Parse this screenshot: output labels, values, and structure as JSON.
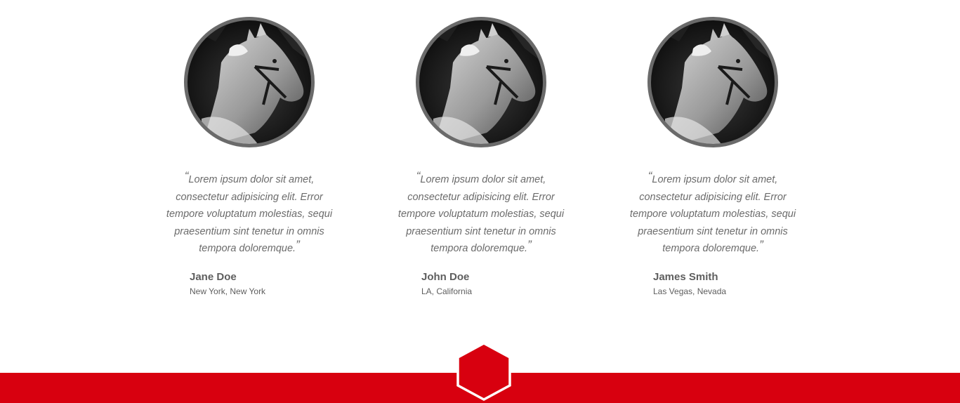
{
  "testimonials": [
    {
      "quote": "Lorem ipsum dolor sit amet, consectetur adipisicing elit. Error tempore voluptatum molestias, sequi praesentium sint tenetur in omnis tempora doloremque.",
      "name": "Jane Doe",
      "location": "New York, New York"
    },
    {
      "quote": "Lorem ipsum dolor sit amet, consectetur adipisicing elit. Error tempore voluptatum molestias, sequi praesentium sint tenetur in omnis tempora doloremque.",
      "name": "John Doe",
      "location": "LA, California"
    },
    {
      "quote": "Lorem ipsum dolor sit amet, consectetur adipisicing elit. Error tempore voluptatum molestias, sequi praesentium sint tenetur in omnis tempora doloremque.",
      "name": "James Smith",
      "location": "Las Vegas, Nevada"
    }
  ],
  "quote_marks": {
    "open": "“",
    "close": "”"
  },
  "colors": {
    "accent": "#d8000f",
    "text": "#6b6b6b",
    "avatar_border": "#6a6a6a"
  },
  "icons": {
    "avatar": "horse-photo-icon",
    "footer_button": "hexagon-icon"
  }
}
